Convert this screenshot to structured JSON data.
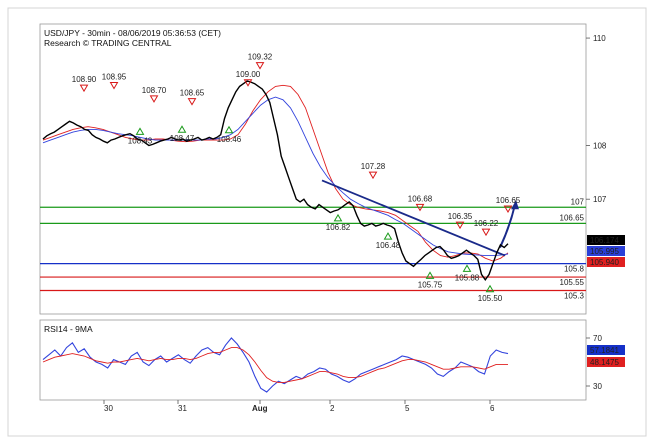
{
  "header": {
    "title": "USD/JPY - 30min - 08/06/2019 05:36:53 (CET)",
    "subtitle": "Research © TRADING CENTRAL"
  },
  "rsi_label": "RSI14 - 9MA",
  "colors": {
    "price": "#000000",
    "ma_red": "#e02020",
    "ma_blue": "#3344dd",
    "support_green": "#1a9a1a",
    "pivot_blue": "#1530c8",
    "resistance_red": "#d81818",
    "arrow": "#1a2a8a",
    "trendline": "#1a2a8a"
  },
  "chart_data": [
    {
      "type": "line",
      "title": "USD/JPY - 30min - 08/06/2019 05:36:53 (CET)",
      "xlabel": "",
      "ylabel": "",
      "ylim": [
        104.9,
        110.15
      ],
      "x_ticks": [
        "30",
        "31",
        "Aug",
        "2",
        "5",
        "6"
      ],
      "y_ticks": [
        110,
        108,
        107
      ],
      "price_series": [
        108.12,
        108.18,
        108.22,
        108.25,
        108.3,
        108.35,
        108.4,
        108.45,
        108.42,
        108.38,
        108.35,
        108.3,
        108.28,
        108.2,
        108.15,
        108.12,
        108.08,
        108.05,
        108.1,
        108.12,
        108.15,
        108.18,
        108.2,
        108.22,
        108.18,
        108.12,
        108.1,
        108.05,
        108.0,
        108.02,
        108.05,
        108.08,
        108.1,
        108.12,
        108.15,
        108.12,
        108.1,
        108.12,
        108.08,
        108.1,
        108.12,
        108.15,
        108.1,
        108.12,
        108.15,
        108.12,
        108.15,
        108.2,
        108.5,
        108.7,
        108.85,
        109.0,
        109.1,
        109.15,
        109.2,
        109.18,
        109.15,
        109.1,
        109.05,
        108.95,
        108.8,
        108.5,
        108.2,
        107.8,
        107.6,
        107.4,
        107.2,
        107.0,
        106.95,
        107.0,
        106.9,
        106.85,
        106.82,
        106.9,
        106.85,
        106.8,
        106.75,
        106.78,
        106.8,
        106.85,
        106.9,
        106.95,
        106.88,
        106.7,
        106.55,
        106.5,
        106.52,
        106.55,
        106.5,
        106.52,
        106.55,
        106.52,
        106.5,
        106.45,
        106.2,
        106.0,
        105.85,
        105.8,
        105.75,
        105.82,
        105.88,
        105.95,
        106.0,
        106.05,
        106.1,
        106.12,
        106.05,
        105.95,
        105.9,
        105.92,
        105.95,
        106.0,
        106.05,
        106.0,
        105.95,
        105.88,
        105.6,
        105.5,
        105.6,
        105.8,
        106.0,
        106.15,
        106.1,
        106.17
      ],
      "series": [
        {
          "name": "",
          "role": "fast moving average",
          "values": [
            108.1,
            108.15,
            108.2,
            108.25,
            108.3,
            108.33,
            108.35,
            108.33,
            108.3,
            108.25,
            108.2,
            108.15,
            108.12,
            108.1,
            108.1,
            108.12,
            108.12,
            108.1,
            108.08,
            108.07,
            108.08,
            108.1,
            108.1,
            108.1,
            108.1,
            108.12,
            108.2,
            108.4,
            108.65,
            108.85,
            109.0,
            109.1,
            109.12,
            109.1,
            108.95,
            108.7,
            108.3,
            107.9,
            107.5,
            107.2,
            107.0,
            106.9,
            106.85,
            106.82,
            106.8,
            106.78,
            106.75,
            106.7,
            106.6,
            106.5,
            106.4,
            106.2,
            106.05,
            105.95,
            105.92,
            105.95,
            106.0,
            106.0,
            105.98,
            105.9,
            105.85,
            105.9,
            106.0
          ]
        },
        {
          "name": "",
          "role": "slow moving average",
          "values": [
            108.05,
            108.1,
            108.15,
            108.2,
            108.25,
            108.28,
            108.3,
            108.3,
            108.28,
            108.25,
            108.22,
            108.2,
            108.18,
            108.15,
            108.12,
            108.1,
            108.1,
            108.1,
            108.1,
            108.1,
            108.1,
            108.1,
            108.12,
            108.12,
            108.15,
            108.2,
            108.3,
            108.45,
            108.6,
            108.75,
            108.85,
            108.9,
            108.85,
            108.7,
            108.45,
            108.15,
            107.85,
            107.6,
            107.4,
            107.25,
            107.12,
            107.0,
            106.92,
            106.85,
            106.8,
            106.75,
            106.7,
            106.62,
            106.55,
            106.45,
            106.35,
            106.25,
            106.15,
            106.08,
            106.02,
            106.0,
            105.98,
            105.97,
            105.96,
            105.95,
            105.95,
            105.96,
            105.98
          ]
        }
      ],
      "price_labels": [
        {
          "text": "108.90",
          "value": 108.9,
          "kind": "high"
        },
        {
          "text": "108.95",
          "value": 108.95,
          "kind": "high"
        },
        {
          "text": "108.70",
          "value": 108.7,
          "kind": "high"
        },
        {
          "text": "108.65",
          "value": 108.65,
          "kind": "high"
        },
        {
          "text": "109.00",
          "value": 109.0,
          "kind": "high"
        },
        {
          "text": "109.32",
          "value": 109.32,
          "kind": "high"
        },
        {
          "text": "108.43",
          "value": 108.43,
          "kind": "low"
        },
        {
          "text": "108.47",
          "value": 108.47,
          "kind": "low"
        },
        {
          "text": "108.46",
          "value": 108.46,
          "kind": "low"
        },
        {
          "text": "107.28",
          "value": 107.28,
          "kind": "high"
        },
        {
          "text": "106.82",
          "value": 106.82,
          "kind": "low"
        },
        {
          "text": "106.68",
          "value": 106.68,
          "kind": "high"
        },
        {
          "text": "106.48",
          "value": 106.48,
          "kind": "low"
        },
        {
          "text": "106.35",
          "value": 106.35,
          "kind": "high"
        },
        {
          "text": "106.22",
          "value": 106.22,
          "kind": "high"
        },
        {
          "text": "106.65",
          "value": 106.65,
          "kind": "high"
        },
        {
          "text": "105.75",
          "value": 105.75,
          "kind": "low"
        },
        {
          "text": "105.88",
          "value": 105.88,
          "kind": "low"
        },
        {
          "text": "105.50",
          "value": 105.5,
          "kind": "low"
        }
      ],
      "levels": [
        {
          "label": "107",
          "value": 106.85,
          "color": "#1a9a1a"
        },
        {
          "label": "106.65",
          "value": 106.55,
          "color": "#1a9a1a"
        },
        {
          "label": "105.8",
          "value": 105.8,
          "color": "#1530c8"
        },
        {
          "label": "105.55",
          "value": 105.55,
          "color": "#d81818"
        },
        {
          "label": "105.3",
          "value": 105.3,
          "color": "#d81818"
        }
      ],
      "price_boxes": [
        {
          "text": "106.174",
          "bg": "#000000",
          "fg": "#ffffff"
        },
        {
          "text": "105.995",
          "bg": "#2a3fd8",
          "fg": "#ffffff"
        },
        {
          "text": "105.940",
          "bg": "#e02020",
          "fg": "#ffffff"
        }
      ]
    },
    {
      "type": "line",
      "title": "RSI14 - 9MA",
      "ylim": [
        20,
        80
      ],
      "y_ticks": [
        70,
        30
      ],
      "series": [
        {
          "name": "",
          "role": "rsi",
          "values": [
            52,
            56,
            60,
            55,
            62,
            66,
            58,
            61,
            54,
            50,
            48,
            45,
            52,
            50,
            48,
            55,
            58,
            50,
            47,
            52,
            55,
            50,
            53,
            56,
            52,
            49,
            55,
            60,
            62,
            58,
            56,
            64,
            70,
            65,
            58,
            50,
            38,
            28,
            25,
            30,
            34,
            32,
            35,
            38,
            36,
            40,
            42,
            45,
            44,
            40,
            38,
            35,
            33,
            36,
            40,
            42,
            44,
            46,
            48,
            50,
            52,
            55,
            54,
            52,
            50,
            48,
            45,
            40,
            38,
            42,
            45,
            50,
            48,
            46,
            42,
            40,
            55,
            60,
            58,
            57
          ]
        },
        {
          "name": "",
          "role": "ma",
          "values": [
            50,
            52,
            54,
            55,
            56,
            57,
            56,
            55,
            53,
            51,
            50,
            49,
            50,
            50,
            51,
            52,
            53,
            52,
            51,
            52,
            53,
            52,
            52,
            53,
            53,
            52,
            53,
            55,
            57,
            58,
            58,
            60,
            62,
            62,
            60,
            56,
            50,
            43,
            37,
            34,
            33,
            33,
            34,
            35,
            36,
            38,
            40,
            42,
            42,
            41,
            40,
            38,
            37,
            37,
            38,
            40,
            42,
            44,
            45,
            47,
            49,
            51,
            52,
            52,
            51,
            50,
            48,
            46,
            44,
            44,
            45,
            46,
            46,
            46,
            45,
            44,
            46,
            48,
            48,
            48
          ]
        }
      ],
      "price_boxes": [
        {
          "text": "57.1841",
          "bg": "#1530c8",
          "fg": "#ffffff"
        },
        {
          "text": "48.1475",
          "bg": "#e02020",
          "fg": "#ffffff"
        }
      ]
    }
  ]
}
